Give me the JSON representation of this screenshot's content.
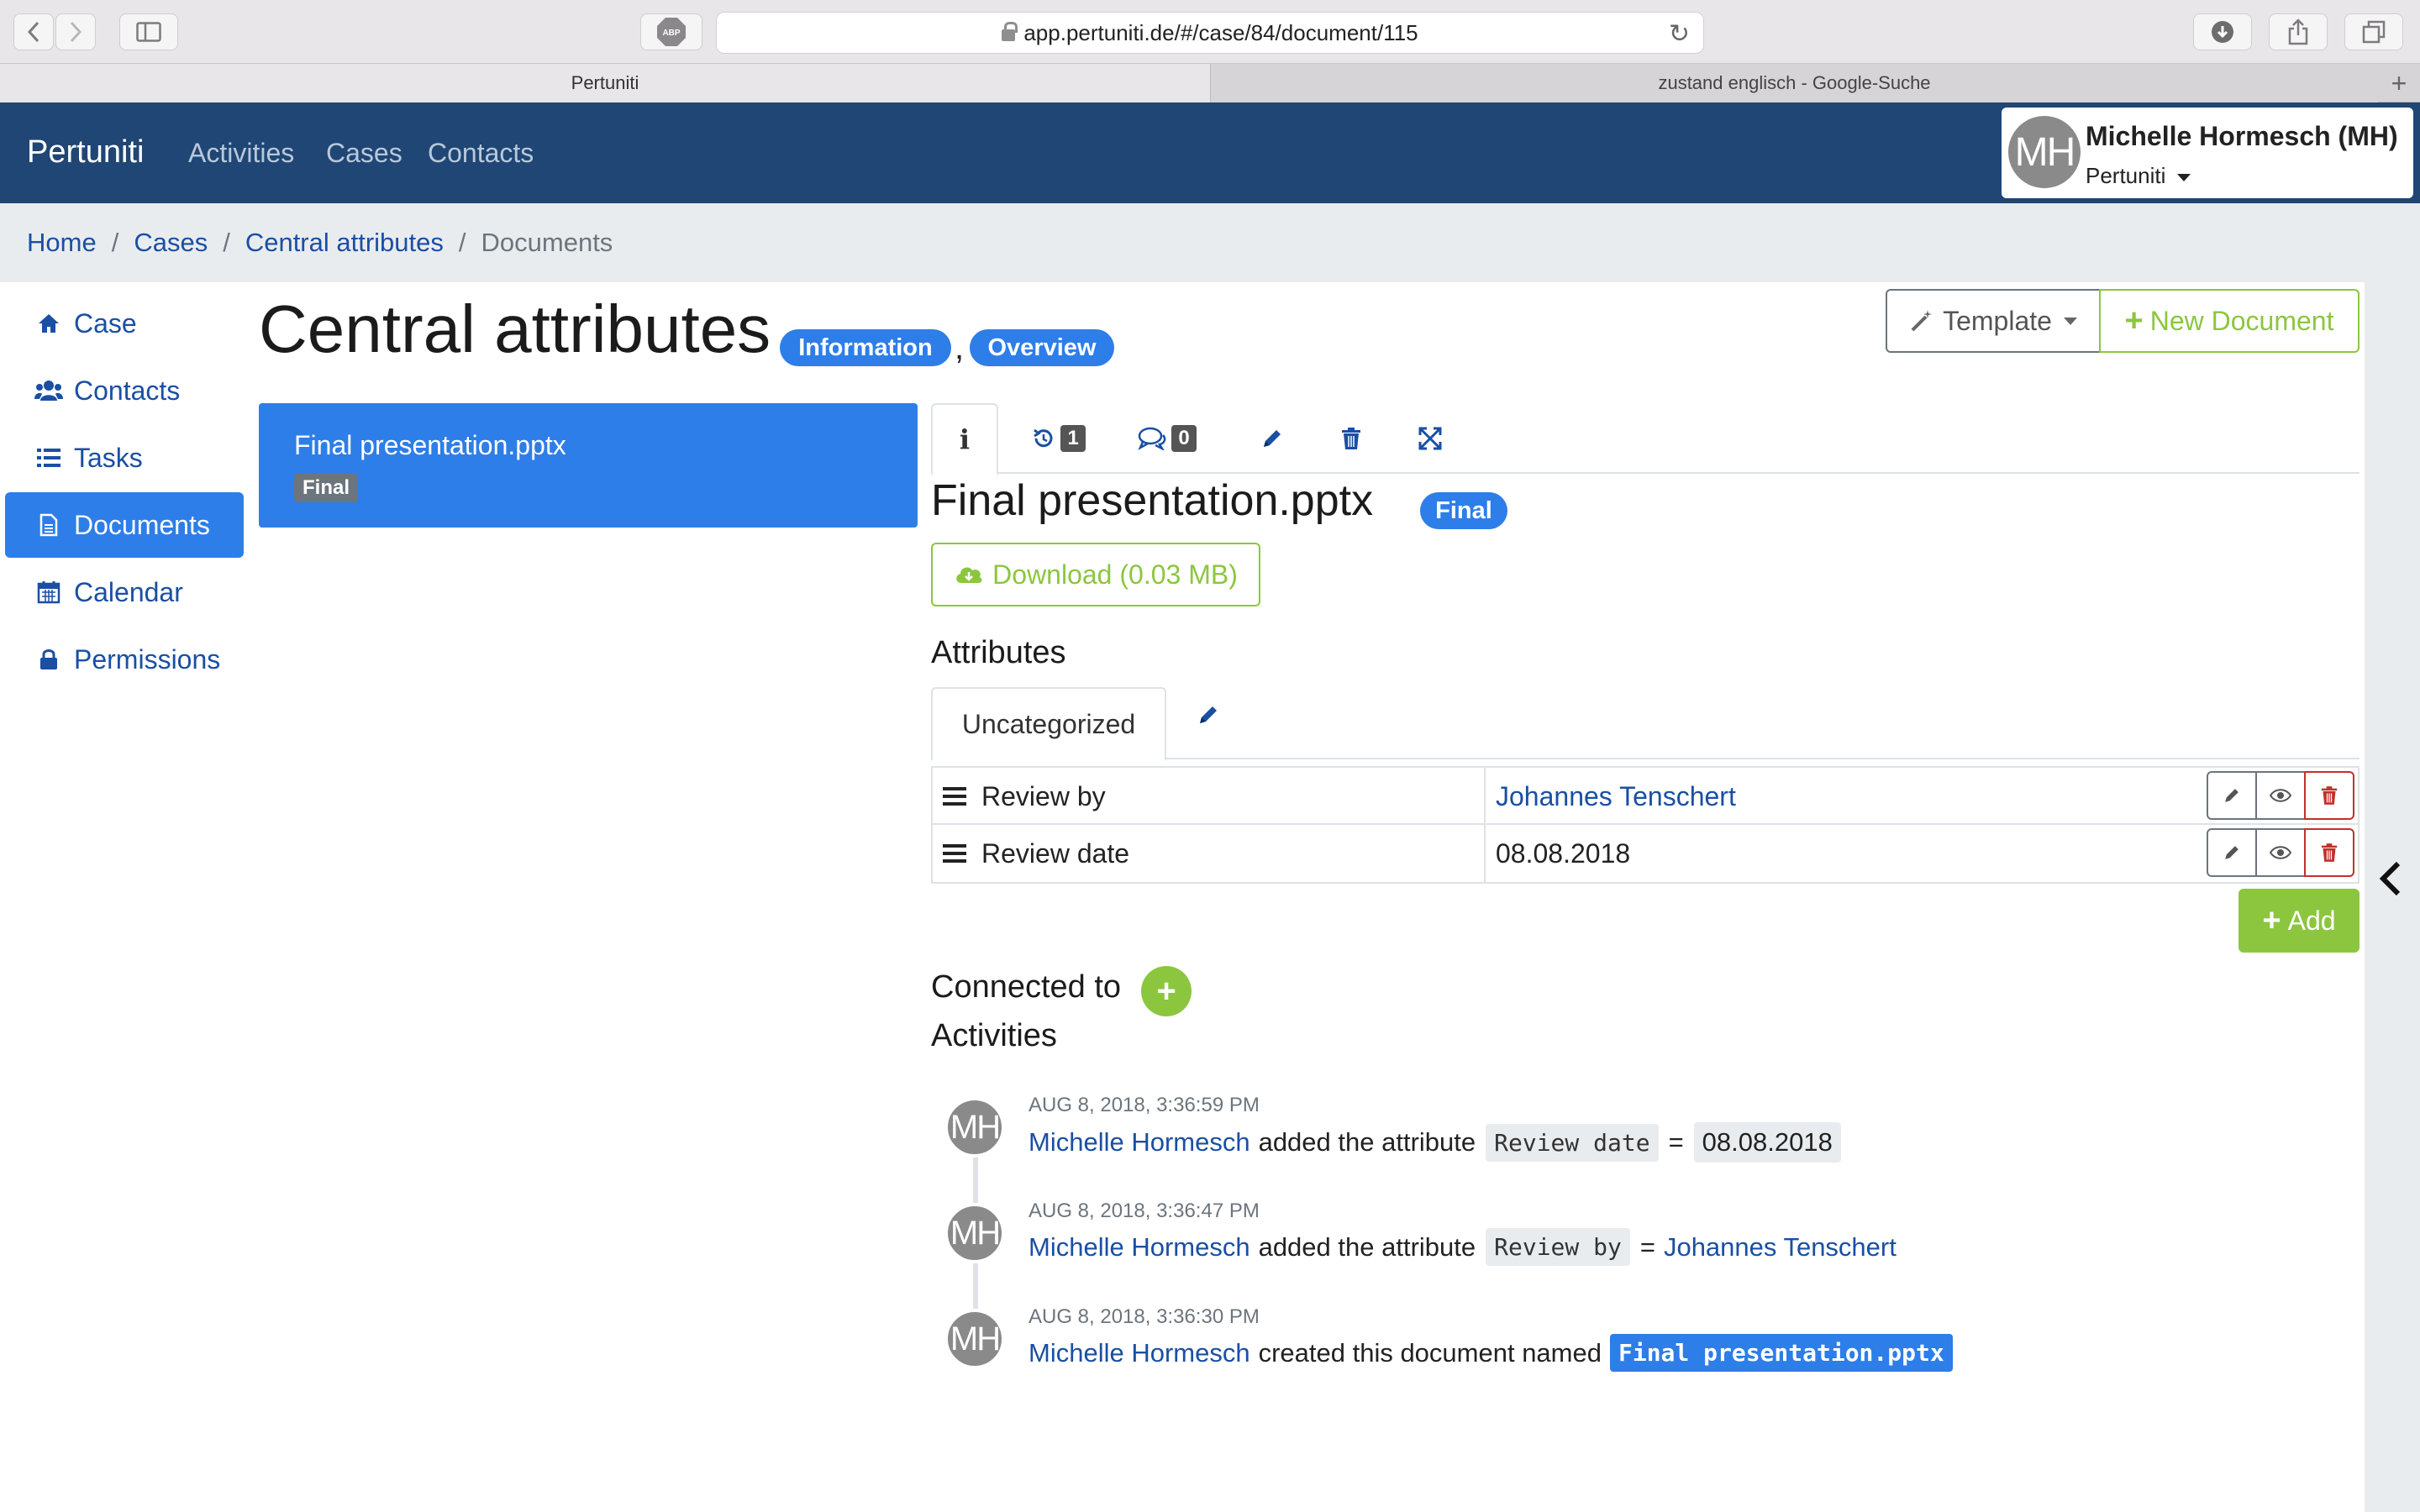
{
  "browser": {
    "url": "app.pertuniti.de/#/case/84/document/115",
    "tabs": [
      {
        "title": "Pertuniti",
        "active": true
      },
      {
        "title": "zustand englisch - Google-Suche",
        "active": false
      }
    ],
    "adblock_label": "ABP"
  },
  "navbar": {
    "brand": "Pertuniti",
    "links": [
      "Activities",
      "Cases",
      "Contacts"
    ],
    "user": {
      "initials": "MH",
      "name": "Michelle Hormesch (MH)",
      "org": "Pertuniti"
    },
    "color": "#1f4674"
  },
  "breadcrumb": {
    "items": [
      "Home",
      "Cases",
      "Central attributes"
    ],
    "current": "Documents"
  },
  "sidebar": {
    "items": [
      {
        "label": "Case",
        "icon": "home-icon",
        "active": false
      },
      {
        "label": "Contacts",
        "icon": "users-icon",
        "active": false
      },
      {
        "label": "Tasks",
        "icon": "list-icon",
        "active": false
      },
      {
        "label": "Documents",
        "icon": "document-icon",
        "active": true
      },
      {
        "label": "Calendar",
        "icon": "calendar-icon",
        "active": false
      },
      {
        "label": "Permissions",
        "icon": "lock-icon",
        "active": false
      }
    ]
  },
  "page": {
    "title": "Central attributes",
    "tags": [
      "Information",
      "Overview"
    ],
    "template_button": "Template",
    "new_document_button": "New Document"
  },
  "documents": [
    {
      "name": "Final presentation.pptx",
      "status": "Final",
      "selected": true
    }
  ],
  "detail": {
    "tabs": {
      "history_count": "1",
      "comments_count": "0"
    },
    "title": "Final presentation.pptx",
    "status": "Final",
    "download_label": "Download (0.03 MB)",
    "attributes_heading": "Attributes",
    "attribute_tab": "Uncategorized",
    "attributes": [
      {
        "key": "Review by",
        "value": "Johannes Tenschert",
        "is_link": true
      },
      {
        "key": "Review date",
        "value": "08.08.2018",
        "is_link": false
      }
    ],
    "add_button": "Add",
    "connected_heading": "Connected to",
    "activities_heading": "Activities"
  },
  "activities": [
    {
      "time": "AUG 8, 2018, 3:36:59 PM",
      "user": "Michelle Hormesch",
      "initials": "MH",
      "action": "added the attribute",
      "attribute": "Review date",
      "equals": "=",
      "value": "08.08.2018"
    },
    {
      "time": "AUG 8, 2018, 3:36:47 PM",
      "user": "Michelle Hormesch",
      "initials": "MH",
      "action": "added the attribute",
      "attribute": "Review by",
      "equals": "=",
      "value": "Johannes Tenschert"
    },
    {
      "time": "AUG 8, 2018, 3:36:30 PM",
      "user": "Michelle Hormesch",
      "initials": "MH",
      "action": "created this document named",
      "value": "Final presentation.pptx"
    }
  ],
  "colors": {
    "primary": "#2d7ee8",
    "link": "#1a4fa3",
    "success": "#8cc63f",
    "danger": "#c0312d"
  }
}
